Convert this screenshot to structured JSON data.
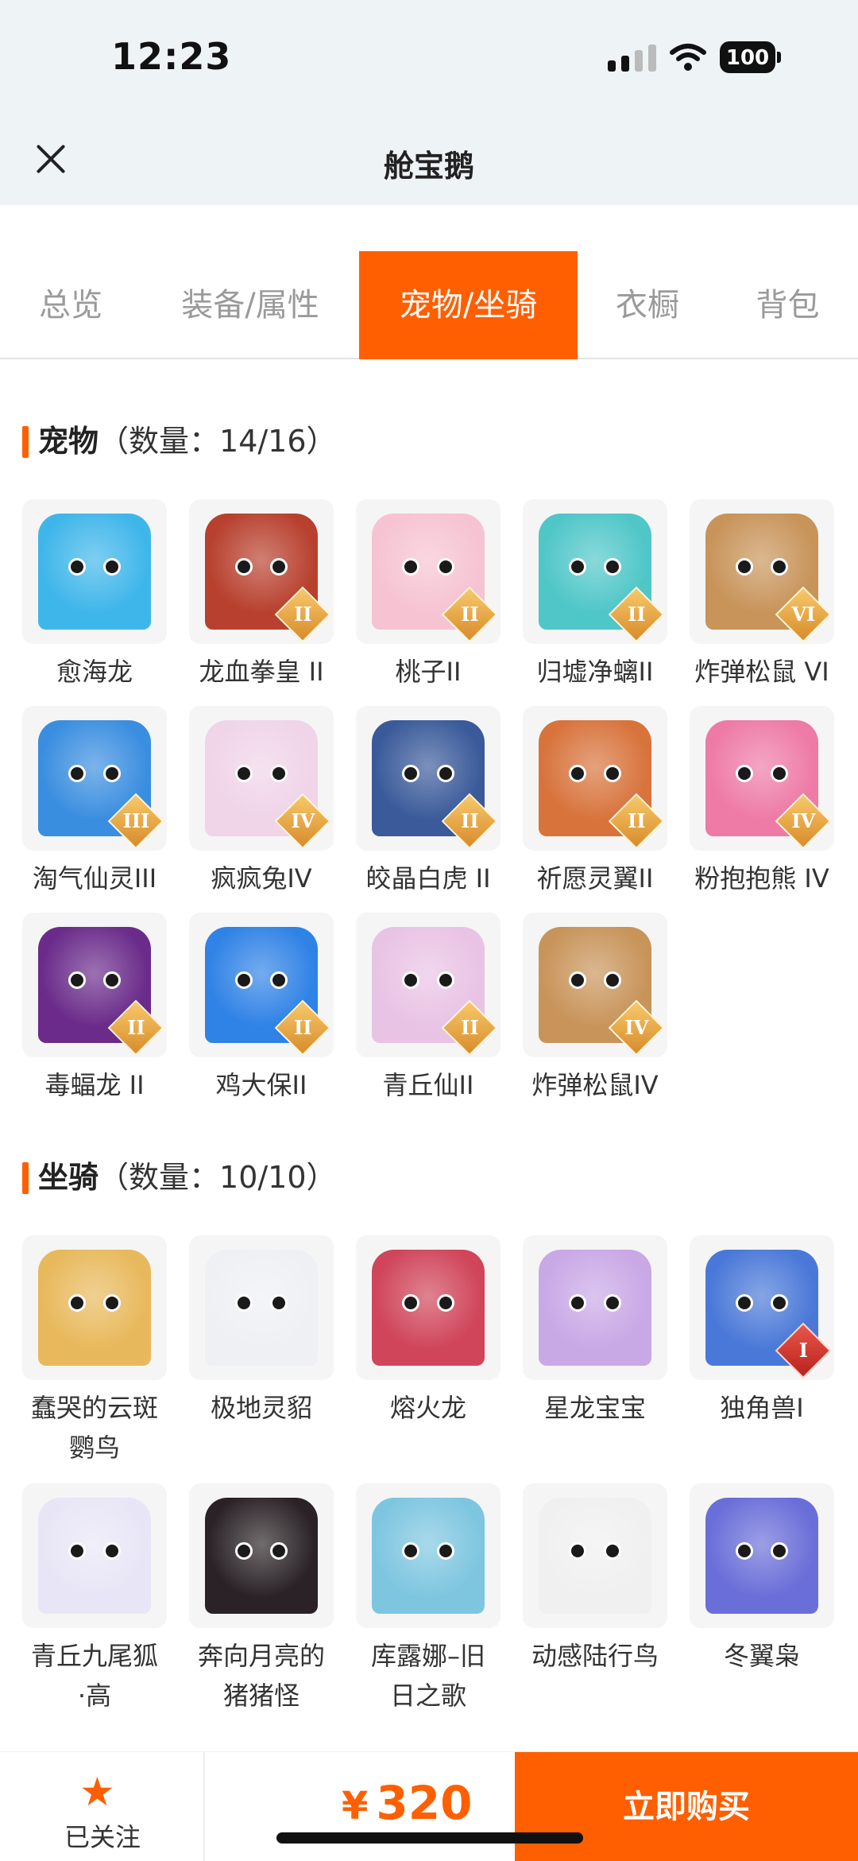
{
  "status_bar": {
    "time": "12:23",
    "battery": "100"
  },
  "nav": {
    "title": "舱宝鹅"
  },
  "tabs": [
    {
      "label": "总览",
      "active": false
    },
    {
      "label": "装备/属性",
      "active": false
    },
    {
      "label": "宠物/坐骑",
      "active": true
    },
    {
      "label": "衣橱",
      "active": false
    },
    {
      "label": "背包",
      "active": false
    }
  ],
  "pets": {
    "heading": "宠物",
    "count": "（数量：14/16）",
    "items": [
      {
        "name": "愈海龙",
        "badge": "",
        "color": "#3fb6ea"
      },
      {
        "name": "龙血拳皇 II",
        "badge": "II",
        "color": "#b8402e"
      },
      {
        "name": "桃子II",
        "badge": "II",
        "color": "#f6c3d2"
      },
      {
        "name": "归墟净螭II",
        "badge": "II",
        "color": "#4fc6c8"
      },
      {
        "name": "炸弹松鼠 VI",
        "badge": "VI",
        "color": "#c8945a"
      },
      {
        "name": "淘气仙灵III",
        "badge": "III",
        "color": "#3a8ee0"
      },
      {
        "name": "疯疯兔IV",
        "badge": "IV",
        "color": "#f0d4e8"
      },
      {
        "name": "皎晶白虎 II",
        "badge": "II",
        "color": "#3a5a9a"
      },
      {
        "name": "祈愿灵翼II",
        "badge": "II",
        "color": "#d8733c"
      },
      {
        "name": "粉抱抱熊 IV",
        "badge": "IV",
        "color": "#ee7aa6"
      },
      {
        "name": "毒蝠龙 II",
        "badge": "II",
        "color": "#6a2b8a"
      },
      {
        "name": "鸡大保II",
        "badge": "II",
        "color": "#2f82e6"
      },
      {
        "name": "青丘仙II",
        "badge": "II",
        "color": "#e9c3e4"
      },
      {
        "name": "炸弹松鼠IV",
        "badge": "IV",
        "color": "#c8945a"
      }
    ]
  },
  "mounts": {
    "heading": "坐骑",
    "count": "（数量：10/10）",
    "items": [
      {
        "name_line1": "蠢哭的云斑",
        "name_line2": "鹦鸟",
        "badge": "",
        "color": "#e8b95c"
      },
      {
        "name_line1": "极地灵貂",
        "name_line2": "",
        "badge": "",
        "color": "#eef0f4"
      },
      {
        "name_line1": "熔火龙",
        "name_line2": "",
        "badge": "",
        "color": "#d0455a"
      },
      {
        "name_line1": "星龙宝宝",
        "name_line2": "",
        "badge": "",
        "color": "#c9a8e6"
      },
      {
        "name_line1": "独角兽I",
        "name_line2": "",
        "badge": "I",
        "color": "#4a78d8"
      },
      {
        "name_line1": "青丘九尾狐",
        "name_line2": "·高",
        "badge": "",
        "color": "#e8e6f6"
      },
      {
        "name_line1": "奔向月亮的",
        "name_line2": "猪猪怪",
        "badge": "",
        "color": "#2a2226"
      },
      {
        "name_line1": "库露娜–旧",
        "name_line2": "日之歌",
        "badge": "",
        "color": "#7ec6e0"
      },
      {
        "name_line1": "动感陆行鸟",
        "name_line2": "",
        "badge": "",
        "color": "#f0f0f0"
      },
      {
        "name_line1": "冬翼枭",
        "name_line2": "",
        "badge": "",
        "color": "#6a6ed8"
      }
    ]
  },
  "bottom": {
    "follow_label": "已关注",
    "star_icon": "star-icon",
    "currency": "¥",
    "price": "320",
    "buy_label": "立即购买"
  }
}
